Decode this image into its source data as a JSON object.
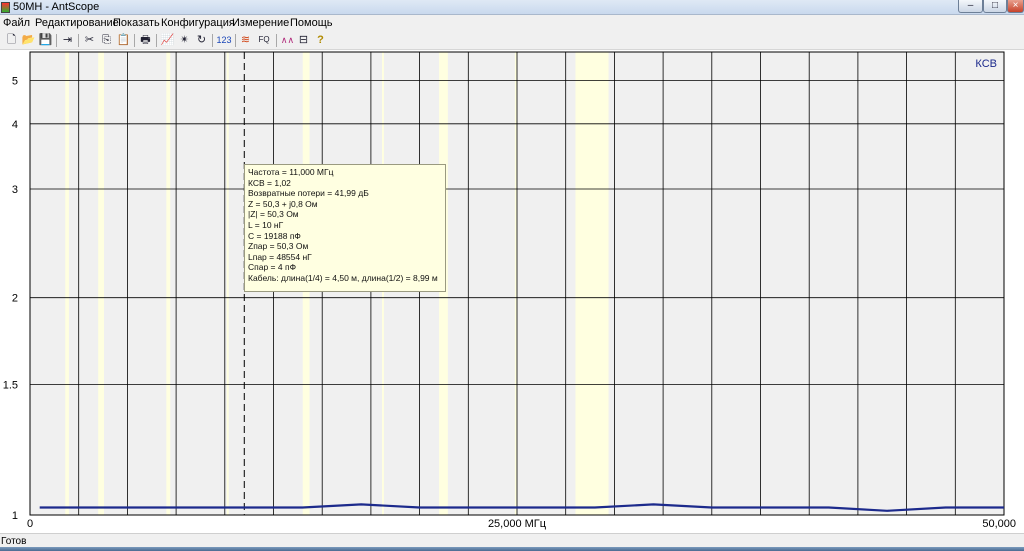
{
  "window": {
    "title": "50MH - AntScope",
    "buttons": {
      "minimize": "–",
      "maximize": "□",
      "close": "×"
    }
  },
  "menu": [
    "Файл",
    "Редактирование",
    "Показать",
    "Конфигурация",
    "Измерение",
    "Помощь"
  ],
  "toolbar": {
    "icons": [
      "new-file-icon",
      "open-folder-icon",
      "save-icon",
      "export-icon",
      "cut-icon",
      "copy-icon",
      "paste-icon",
      "print-icon",
      "chart-icon",
      "settings-star-icon",
      "refresh-icon",
      "numeric-icon",
      "antenna-icon",
      "fq-icon",
      "impedance-icon",
      "cable-icon",
      "help-icon"
    ],
    "glyphs": [
      "🗋",
      "📂",
      "💾",
      "⇥",
      "✂",
      "⎘",
      "📋",
      "🖶",
      "📈",
      "✴",
      "↻",
      "",
      "≋",
      "",
      "∧∧",
      "⊟",
      "?"
    ],
    "numeric_label": "123",
    "fq_label": "FQ"
  },
  "tooltip": {
    "lines": [
      "Частота = 11,000 МГц",
      "КСВ = 1,02",
      "Возвратные потери = 41,99 дБ",
      "Z = 50,3 + j0,8 Ом",
      "|Z| = 50,3 Ом",
      "L = 10 нГ",
      "C = 19188 пФ",
      "Zпар = 50,3 Ом",
      "Lпар = 48554 нГ",
      "Cпар = 4 пФ",
      "Кабель: длина(1/4) = 4,50 м, длина(1/2) = 8,99 м"
    ]
  },
  "status": {
    "text": "Готов"
  },
  "colors": {
    "plot_bg": "#f0f0f0",
    "band_highlight": "#ffffe0",
    "grid": "#000000",
    "series": "#1c2a8c",
    "series_label": "#1c2a8c"
  },
  "chart_data": {
    "type": "line",
    "title": "",
    "series": [
      {
        "name": "КСВ",
        "x": [
          0.5,
          2,
          5,
          8,
          11,
          14,
          17,
          20,
          23,
          26,
          29,
          32,
          35,
          38,
          41,
          44,
          47,
          50
        ],
        "y": [
          1.02,
          1.02,
          1.02,
          1.02,
          1.02,
          1.02,
          1.03,
          1.02,
          1.02,
          1.02,
          1.02,
          1.03,
          1.02,
          1.02,
          1.02,
          1.01,
          1.02,
          1.02
        ]
      }
    ],
    "xlim": [
      0,
      50
    ],
    "ylim": [
      1,
      5.9
    ],
    "y_scale": "swr",
    "y_ticks": [
      1,
      1.5,
      2,
      3,
      4,
      5
    ],
    "x_ticks": [
      0,
      25,
      50
    ],
    "x_tick_labels": [
      "0",
      "25,000 МГц",
      "50,000"
    ],
    "bands_mhz": [
      [
        1.81,
        2.0
      ],
      [
        3.5,
        3.8
      ],
      [
        7.0,
        7.2
      ],
      [
        10.1,
        10.15
      ],
      [
        14.0,
        14.35
      ],
      [
        18.068,
        18.168
      ],
      [
        21.0,
        21.45
      ],
      [
        24.89,
        24.99
      ],
      [
        28.0,
        29.7
      ]
    ],
    "cursor_x": 11.0,
    "grid": true
  }
}
